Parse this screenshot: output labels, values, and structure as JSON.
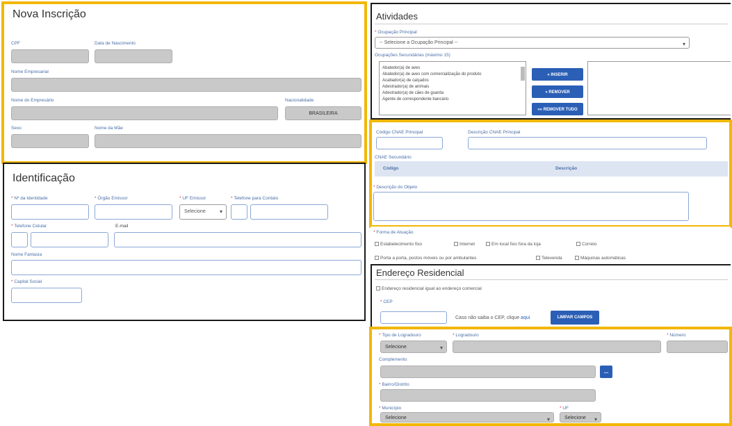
{
  "nova": {
    "title": "Nova Inscrição",
    "cpf_label": "CPF",
    "nascimento_label": "Data de Nascimento",
    "nome_empresarial_label": "Nome Empresarial",
    "nome_empresario_label": "Nome do Empresário",
    "nacionalidade_label": "Nacionalidade",
    "nacionalidade_value": "BRASILEIRA",
    "sexo_label": "Sexo",
    "nome_mae_label": "Nome da Mãe"
  },
  "identificacao": {
    "title": "Identificação",
    "identidade_label": "Nº da Identidade",
    "orgao_label": "Órgão Emissor",
    "uf_label": "UF Emissor",
    "uf_select": "Selecione",
    "telefone_contato_label": "Telefone para Contato",
    "telefone_celular_label": "Telefone Celular",
    "email_label": "E-mail",
    "nome_fantasia_label": "Nome Fantasia",
    "capital_label": "Capital Social"
  },
  "atividades": {
    "title": "Atividades",
    "ocupacao_label": "Ocupação Principal",
    "ocupacao_select": "-- Selecione a Ocupação Principal --",
    "secundarias_label": "Ocupações Secundárias (máximo 15)",
    "list_items": [
      "Abatedor(a) de aves",
      "Abatedor(a) de aves com comercialização do produto",
      "Acabador(a) de calçados",
      "Adestrador(a) de animais",
      "Adestrador(a) de cães de guarda",
      "Agente de correspondente bancário"
    ],
    "btn_inserir": "» INSERIR",
    "btn_remover": "« REMOVER",
    "btn_remover_tudo": "«« REMOVER TUDO"
  },
  "cnae": {
    "codigo_label": "Código CNAE Principal",
    "descricao_label": "Descrição CNAE Principal",
    "secundario_label": "CNAE Secundário",
    "col_codigo": "Código",
    "col_descricao": "Descrição",
    "objeto_label": "Descrição do Objeto"
  },
  "atuacao": {
    "label": "Forma de Atuação",
    "options": [
      "Estabelecimento fixo",
      "Internet",
      "Em local fixo fora da loja",
      "Correio",
      "Porta a porta, postos móveis ou por ambulantes",
      "Televenda",
      "Máquinas automáticas"
    ]
  },
  "endereco": {
    "title": "Endereço Residencial",
    "igual_label": "Endereço residencial igual ao endereço comercial",
    "cep_label": "CEP",
    "cep_help_prefix": "Caso não saiba o CEP, clique ",
    "cep_help_link": "aqui",
    "btn_limpar": "LIMPAR CAMPOS",
    "tipo_label": "Tipo de Logradouro",
    "tipo_select": "Selecione",
    "logradouro_label": "Logradouro",
    "numero_label": "Número",
    "complemento_label": "Complemento",
    "complemento_btn": "...",
    "bairro_label": "Bairro/Distrito",
    "municipio_label": "Município",
    "municipio_select": "Selecione",
    "uf_label": "UF",
    "uf_select": "Selecione"
  }
}
